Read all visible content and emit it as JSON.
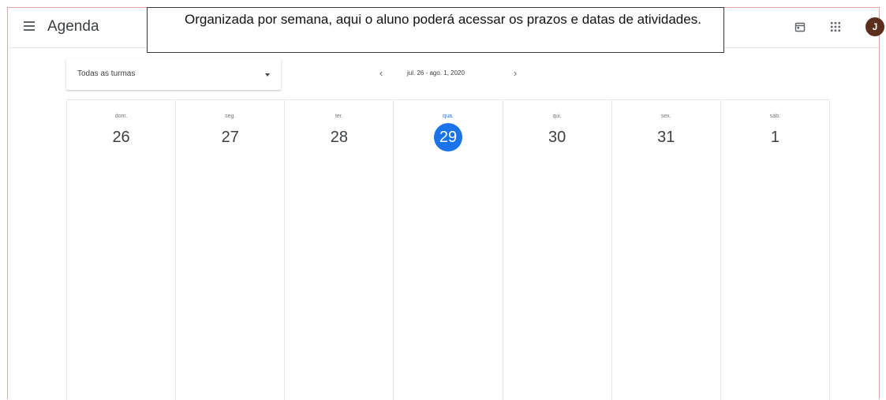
{
  "header": {
    "title": "Agenda",
    "avatar_initial": "J",
    "icons": [
      "menu-icon",
      "calendar-icon",
      "apps-grid-icon"
    ]
  },
  "callout": {
    "text": "Organizada por semana, aqui o aluno poderá acessar os prazos e datas de atividades."
  },
  "filter": {
    "class_select": "Todas as turmas"
  },
  "week_nav": {
    "range": "jul. 26 - ago. 1, 2020"
  },
  "days": [
    {
      "name": "dom.",
      "number": "26"
    },
    {
      "name": "seg.",
      "number": "27"
    },
    {
      "name": "ter.",
      "number": "28"
    },
    {
      "name": "qua.",
      "number": "29",
      "today": true
    },
    {
      "name": "qui.",
      "number": "30"
    },
    {
      "name": "sex.",
      "number": "31"
    },
    {
      "name": "sáb.",
      "number": "1"
    }
  ],
  "colors": {
    "accent": "#1a73e8",
    "avatar": "#5b2f1c",
    "frame": "#e8a3a3"
  }
}
